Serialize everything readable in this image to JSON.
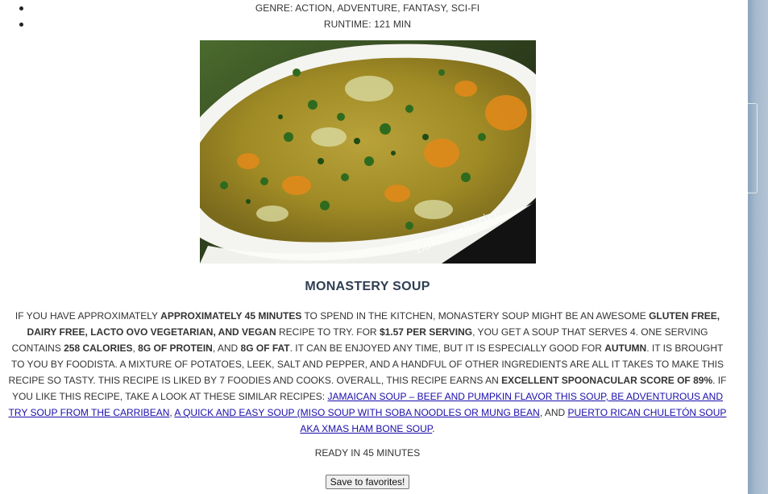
{
  "movie": {
    "genre": "GENRE: ACTION, ADVENTURE, FANTASY, SCI-FI",
    "runtime": "RUNTIME: 121 MIN"
  },
  "recipe": {
    "photo_watermark": "Laka kuharica",
    "title": "MONASTERY SOUP",
    "desc": {
      "t1": "IF YOU HAVE APPROXIMATELY ",
      "b1": "APPROXIMATELY 45 MINUTES",
      "t2": " TO SPEND IN THE KITCHEN, MONASTERY SOUP MIGHT BE AN AWESOME ",
      "b2": "GLUTEN FREE, DAIRY FREE, LACTO OVO VEGETARIAN, AND VEGAN",
      "t3": " RECIPE TO TRY. FOR ",
      "b3": "$1.57 PER SERVING",
      "t4": ", YOU GET A SOUP THAT SERVES 4. ONE SERVING CONTAINS ",
      "b4": "258 CALORIES",
      "t5": ", ",
      "b5": "8G OF PROTEIN",
      "t6": ", AND ",
      "b6": "8G OF FAT",
      "t7": ". IT CAN BE ENJOYED ANY TIME, BUT IT IS ESPECIALLY GOOD FOR ",
      "b7": "AUTUMN",
      "t8": ". IT IS BROUGHT TO YOU BY FOODISTA. A MIXTURE OF POTATOES, LEEK, SALT AND PEPPER, AND A HANDFUL OF OTHER INGREDIENTS ARE ALL IT TAKES TO MAKE THIS RECIPE SO TASTY. THIS RECIPE IS LIKED BY 7 FOODIES AND COOKS. OVERALL, THIS RECIPE EARNS AN ",
      "b8": "EXCELLENT SPOONACULAR SCORE OF 89%",
      "t9": ". IF YOU LIKE THIS RECIPE, TAKE A LOOK AT THESE SIMILAR RECIPES: ",
      "link1": "JAMAICAN SOUP – BEEF AND PUMPKIN FLAVOR THIS SOUP, BE ADVENTUROUS AND TRY SOUP FROM THE CARRIBEAN",
      "t10": ", ",
      "link2": "A QUICK AND EASY SOUP (MISO SOUP WITH SOBA NOODLES OR MUNG BEAN",
      "t11": ", AND ",
      "link3": "PUERTO RICAN CHULETÓN SOUP AKA XMAS HAM BONE SOUP",
      "t12": "."
    },
    "ready": "READY IN 45 MINUTES",
    "save_label": "Save to favorites!"
  }
}
